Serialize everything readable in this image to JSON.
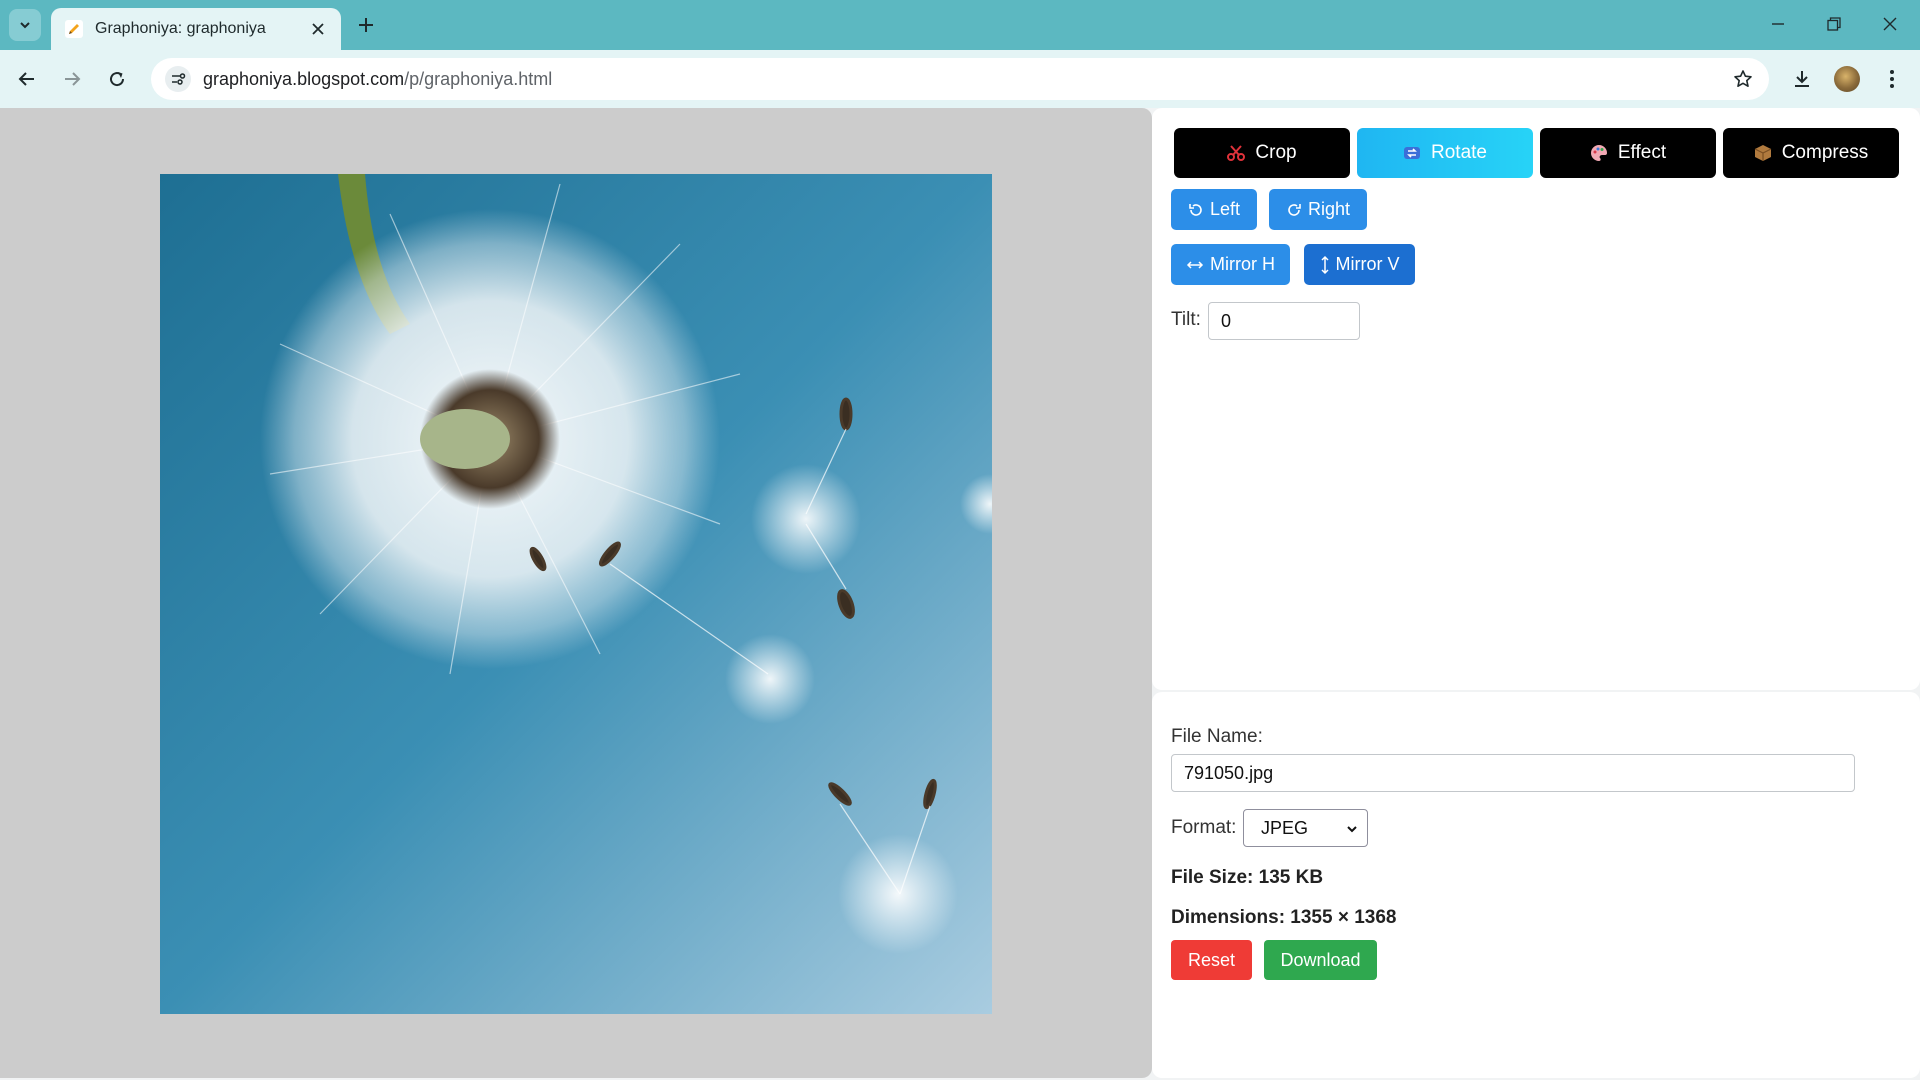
{
  "browser": {
    "tab_title": "Graphoniya: graphoniya",
    "url_host": "graphoniya.blogspot.com",
    "url_path": "/p/graphoniya.html"
  },
  "tool_tabs": [
    {
      "label": "Crop",
      "icon": "scissors-icon"
    },
    {
      "label": "Rotate",
      "icon": "rotate-icon"
    },
    {
      "label": "Effect",
      "icon": "palette-icon"
    },
    {
      "label": "Compress",
      "icon": "package-icon"
    }
  ],
  "rotate": {
    "left_label": "Left",
    "right_label": "Right",
    "mirror_h_label": "Mirror H",
    "mirror_v_label": "Mirror V",
    "tilt_label": "Tilt:",
    "tilt_value": "0"
  },
  "file": {
    "name_label": "File Name:",
    "name_value": "791050.jpg",
    "format_label": "Format:",
    "format_value": "JPEG",
    "size_text": "File Size: 135 KB",
    "dimensions_text": "Dimensions: 1355 × 1368"
  },
  "actions": {
    "reset_label": "Reset",
    "download_label": "Download"
  },
  "colors": {
    "accent_active": "#1fb6f2",
    "button_blue": "#2c8ee8",
    "reset_red": "#ef3b36",
    "download_green": "#2fa84f",
    "sky": "#3b8fb4"
  }
}
